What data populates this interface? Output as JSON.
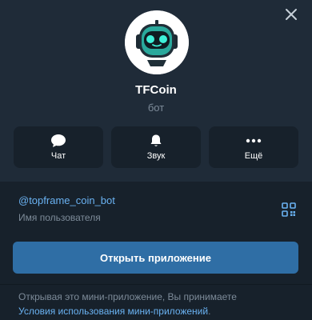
{
  "header": {
    "bot_name": "TFCoin",
    "bot_type": "бот"
  },
  "actions": [
    {
      "label": "Чат",
      "icon": "chat-bubble-icon"
    },
    {
      "label": "Звук",
      "icon": "bell-icon"
    },
    {
      "label": "Ещё",
      "icon": "more-dots-icon"
    }
  ],
  "info": {
    "username": "@topframe_coin_bot",
    "username_caption": "Имя пользователя"
  },
  "open_button_label": "Открыть приложение",
  "terms": {
    "text": "Открывая это мини-приложение, Вы принимаете",
    "link": "Условия использования мини-приложений",
    "tail": "."
  },
  "colors": {
    "background": "#17212b",
    "panel": "#1f2b38",
    "accent_link": "#6ab2f2",
    "button": "#2f6ea5",
    "muted_text": "#7d8b99",
    "robot_face": "#2fd3c2"
  }
}
